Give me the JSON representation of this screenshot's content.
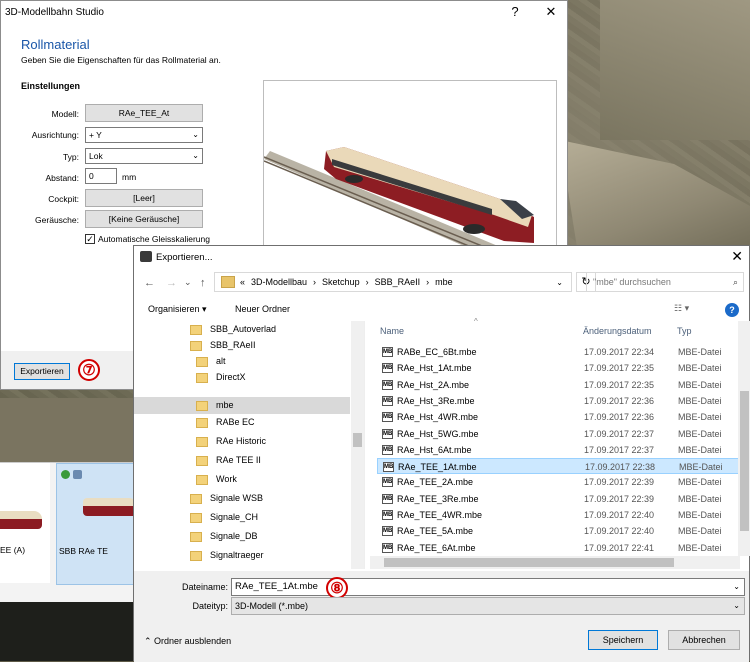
{
  "rollmaterial_dialog": {
    "window_title": "3D-Modellbahn Studio",
    "help_button": "?",
    "close_button": "✕",
    "heading": "Rollmaterial",
    "subtitle": "Geben Sie die Eigenschaften für das Rollmaterial an.",
    "section": "Einstellungen",
    "fields": {
      "modell_label": "Modell:",
      "modell_value": "RAe_TEE_At",
      "ausrichtung_label": "Ausrichtung:",
      "ausrichtung_value": "+ Y",
      "typ_label": "Typ:",
      "typ_value": "Lok",
      "abstand_label": "Abstand:",
      "abstand_value": "0",
      "abstand_unit": "mm",
      "cockpit_label": "Cockpit:",
      "cockpit_value": "[Leer]",
      "geraeusche_label": "Geräusche:",
      "geraeusche_value": "[Keine Geräusche]",
      "auto_scaling_label": "Automatische Gleisskalierung",
      "auto_scaling_checked": true
    },
    "export_button": "Exportieren",
    "step_badge": "⑦"
  },
  "library_panel": {
    "item1_label": "EE (A)",
    "item2_label": "SBB RAe TE"
  },
  "export_dialog": {
    "title": "Exportieren...",
    "close_button": "✕",
    "nav": {
      "back": "←",
      "forward": "→",
      "dropdown": "⌄",
      "up": "↑"
    },
    "breadcrumb": [
      "«",
      "3D-Modellbau",
      "›",
      "Sketchup",
      "›",
      "SBB_RAeII",
      "›",
      "mbe"
    ],
    "breadcrumb_dropdown": "⌄",
    "refresh": "↻",
    "search_placeholder": "\"mbe\" durchsuchen",
    "search_icon": "⌕",
    "toolbar": {
      "organize": "Organisieren ▾",
      "new_folder": "Neuer Ordner",
      "view": "☷ ▾",
      "help": "?"
    },
    "tree": [
      "SBB_Autoverlad",
      "SBB_RAeII",
      "alt",
      "DirectX",
      "mbe",
      "RABe EC",
      "RAe Historic",
      "RAe TEE II",
      "Work",
      "Signale WSB",
      "Signale_CH",
      "Signale_DB",
      "Signaltraeger"
    ],
    "tree_selected": 4,
    "columns": {
      "name": "Name",
      "date": "Änderungsdatum",
      "type": "Typ"
    },
    "sort_indicator": "^",
    "files": [
      {
        "name": "RABe_EC_6Bt.mbe",
        "date": "17.09.2017 22:34",
        "type": "MBE-Datei"
      },
      {
        "name": "RAe_Hst_1At.mbe",
        "date": "17.09.2017 22:35",
        "type": "MBE-Datei"
      },
      {
        "name": "RAe_Hst_2A.mbe",
        "date": "17.09.2017 22:35",
        "type": "MBE-Datei"
      },
      {
        "name": "RAe_Hst_3Re.mbe",
        "date": "17.09.2017 22:36",
        "type": "MBE-Datei"
      },
      {
        "name": "RAe_Hst_4WR.mbe",
        "date": "17.09.2017 22:36",
        "type": "MBE-Datei"
      },
      {
        "name": "RAe_Hst_5WG.mbe",
        "date": "17.09.2017 22:37",
        "type": "MBE-Datei"
      },
      {
        "name": "RAe_Hst_6At.mbe",
        "date": "17.09.2017 22:37",
        "type": "MBE-Datei"
      },
      {
        "name": "RAe_TEE_1At.mbe",
        "date": "17.09.2017 22:38",
        "type": "MBE-Datei"
      },
      {
        "name": "RAe_TEE_2A.mbe",
        "date": "17.09.2017 22:39",
        "type": "MBE-Datei"
      },
      {
        "name": "RAe_TEE_3Re.mbe",
        "date": "17.09.2017 22:39",
        "type": "MBE-Datei"
      },
      {
        "name": "RAe_TEE_4WR.mbe",
        "date": "17.09.2017 22:40",
        "type": "MBE-Datei"
      },
      {
        "name": "RAe_TEE_5A.mbe",
        "date": "17.09.2017 22:40",
        "type": "MBE-Datei"
      },
      {
        "name": "RAe_TEE_6At.mbe",
        "date": "17.09.2017 22:41",
        "type": "MBE-Datei"
      }
    ],
    "file_selected": 7,
    "file_icon_text": "MB",
    "filename_label": "Dateiname:",
    "filename_value": "RAe_TEE_1At.mbe",
    "filetype_label": "Dateityp:",
    "filetype_value": "3D-Modell (*.mbe)",
    "hide_folders": "⌃  Ordner ausblenden",
    "save_button": "Speichern",
    "cancel_button": "Abbrechen",
    "step_badge": "⑧"
  },
  "colors": {
    "accent": "#0078d7",
    "heading": "#1a56a8",
    "badge": "#d10000",
    "selection": "#cce8ff"
  }
}
